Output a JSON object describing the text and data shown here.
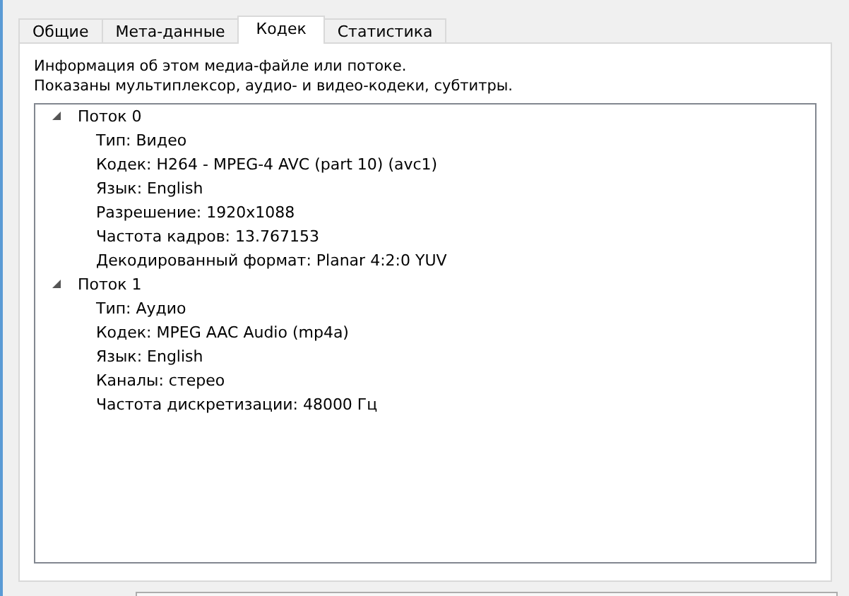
{
  "tabs": [
    {
      "label": "Общие",
      "selected": false
    },
    {
      "label": "Мета-данные",
      "selected": false
    },
    {
      "label": "Кодек",
      "selected": true
    },
    {
      "label": "Статистика",
      "selected": false
    }
  ],
  "info": [
    "Информация об этом медиа-файле или потоке.",
    "Показаны мультиплексор, аудио- и видео-кодеки, субтитры."
  ],
  "tree": [
    {
      "label": "Поток 0",
      "expanded": true,
      "children": [
        {
          "label": "Тип: Видео"
        },
        {
          "label": "Кодек: H264 - MPEG-4 AVC (part 10) (avc1)"
        },
        {
          "label": "Язык: English"
        },
        {
          "label": "Разрешение: 1920x1088"
        },
        {
          "label": "Частота кадров: 13.767153"
        },
        {
          "label": "Декодированный формат: Planar 4:2:0 YUV"
        }
      ]
    },
    {
      "label": "Поток 1",
      "expanded": true,
      "children": [
        {
          "label": "Тип: Аудио"
        },
        {
          "label": "Кодек: MPEG AAC Audio (mp4a)"
        },
        {
          "label": "Язык: English"
        },
        {
          "label": "Каналы: стерео"
        },
        {
          "label": "Частота дискретизации: 48000 Гц"
        }
      ]
    }
  ]
}
